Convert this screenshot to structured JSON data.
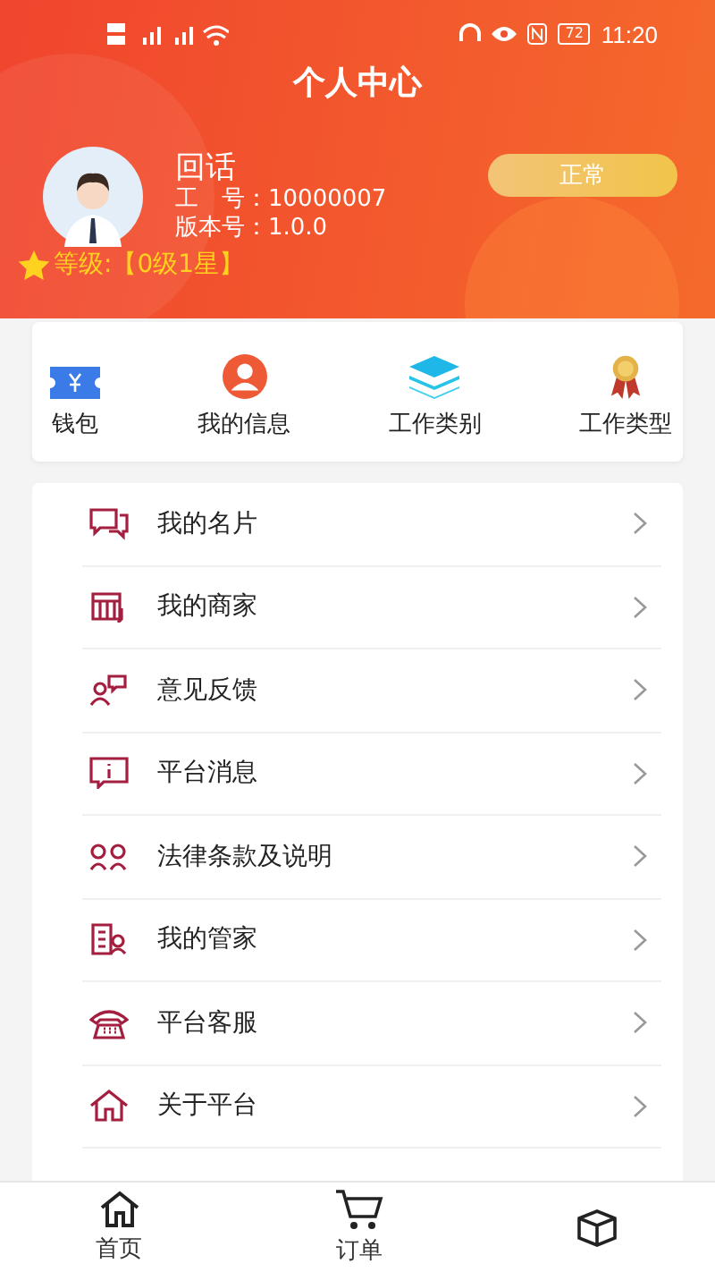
{
  "status_bar": {
    "time": "11:20",
    "battery": "72"
  },
  "title": "个人中心",
  "profile": {
    "name": "回话",
    "id_label": "工　号：",
    "id_value": "10000007",
    "version_label": "版本号：",
    "version_value": "1.0.0",
    "status": "正常",
    "level_label": "等级:",
    "level_value": "【0级1星】"
  },
  "shortcuts": [
    {
      "kind": "wallet",
      "label": "钱包"
    },
    {
      "kind": "person",
      "label": "我的信息"
    },
    {
      "kind": "layers",
      "label": "工作类别"
    },
    {
      "kind": "medal",
      "label": "工作类型"
    }
  ],
  "menu": [
    {
      "kind": "card",
      "label": "我的名片"
    },
    {
      "kind": "shop",
      "label": "我的商家"
    },
    {
      "kind": "feedback",
      "label": "意见反馈"
    },
    {
      "kind": "message",
      "label": "平台消息"
    },
    {
      "kind": "people",
      "label": "法律条款及说明"
    },
    {
      "kind": "steward",
      "label": "我的管家"
    },
    {
      "kind": "phone",
      "label": "平台客服"
    },
    {
      "kind": "home",
      "label": "关于平台"
    }
  ],
  "nav": [
    {
      "kind": "home",
      "label": "首页"
    },
    {
      "kind": "cart",
      "label": "订单"
    },
    {
      "kind": "box"
    }
  ]
}
